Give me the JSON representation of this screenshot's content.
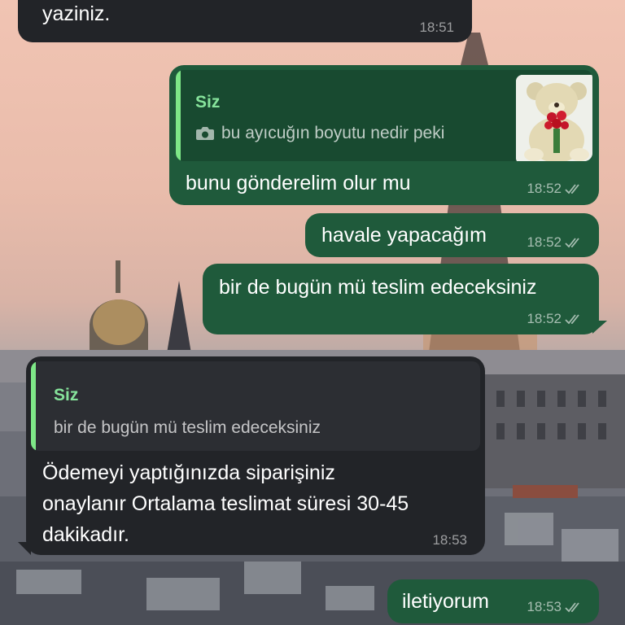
{
  "messages": [
    {
      "id": "m0",
      "direction": "incoming",
      "text": "yaziniz.",
      "time": "18:51"
    },
    {
      "id": "m1",
      "direction": "outgoing",
      "reply": {
        "author": "Siz",
        "icon": "camera-icon",
        "text": "bu ayıcuğın boyutu nedir peki",
        "thumbnail": "teddy-bear-with-roses"
      },
      "text": "bunu gönderelim olur mu",
      "time": "18:52",
      "status": "read"
    },
    {
      "id": "m2",
      "direction": "outgoing",
      "text": "havale yapacağım",
      "time": "18:52",
      "status": "read"
    },
    {
      "id": "m3",
      "direction": "outgoing",
      "text": "bir de bugün mü teslim edeceksiniz",
      "time": "18:52",
      "status": "read"
    },
    {
      "id": "m4",
      "direction": "incoming",
      "reply": {
        "author": "Siz",
        "text": "bir de bugün mü teslim edeceksiniz"
      },
      "lines": [
        "Ödemeyi yaptığınızda siparişiniz",
        "onaylanır Ortalama teslimat süresi 30-45",
        "dakikadır."
      ],
      "time": "18:53"
    },
    {
      "id": "m5",
      "direction": "outgoing",
      "text": "iletiyorum",
      "time": "18:53",
      "status": "read"
    }
  ],
  "colors": {
    "outgoing_bubble": "#1f5a3b",
    "incoming_bubble": "#222428",
    "quote_accent": "#7ee787"
  }
}
